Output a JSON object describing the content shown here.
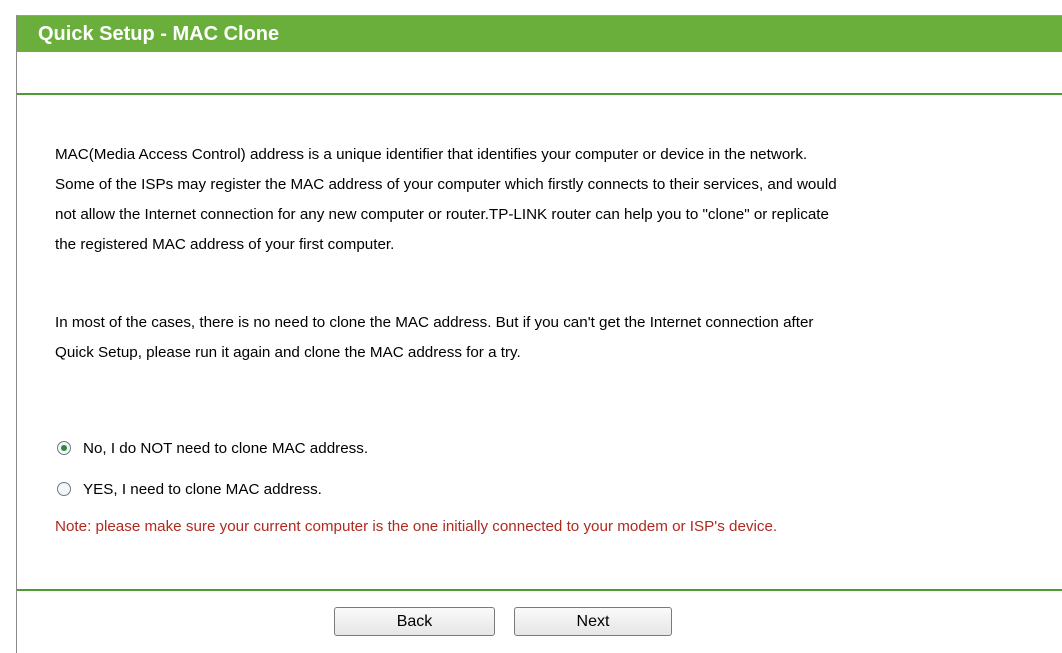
{
  "header": {
    "title": "Quick Setup - MAC Clone"
  },
  "main": {
    "paragraphs": [
      "MAC(Media Access Control) address is a unique identifier that identifies your computer or device in the network.\nSome of the ISPs may register the MAC address of your computer which firstly connects to their services, and would\nnot allow the Internet connection for any new computer or router.TP-LINK router can help you to \"clone\" or replicate\nthe registered MAC address of your first computer.",
      "In most of the cases, there is no need to clone the MAC address. But if you can't get the Internet connection after\nQuick Setup, please run it again and clone the MAC address for a try."
    ],
    "options": [
      {
        "label": "No, I do NOT need to clone MAC address.",
        "selected": true
      },
      {
        "label": "YES, I need to clone MAC address.",
        "selected": false
      }
    ],
    "note": "Note: please make sure your current computer is the one initially connected to your modem or ISP's device."
  },
  "buttons": {
    "back_label": "Back",
    "next_label": "Next"
  },
  "colors": {
    "title_bar": "#6aaf3b",
    "divider": "#4f9a38",
    "note_text": "#b02a20",
    "radio_dot": "#2e8b3a"
  }
}
